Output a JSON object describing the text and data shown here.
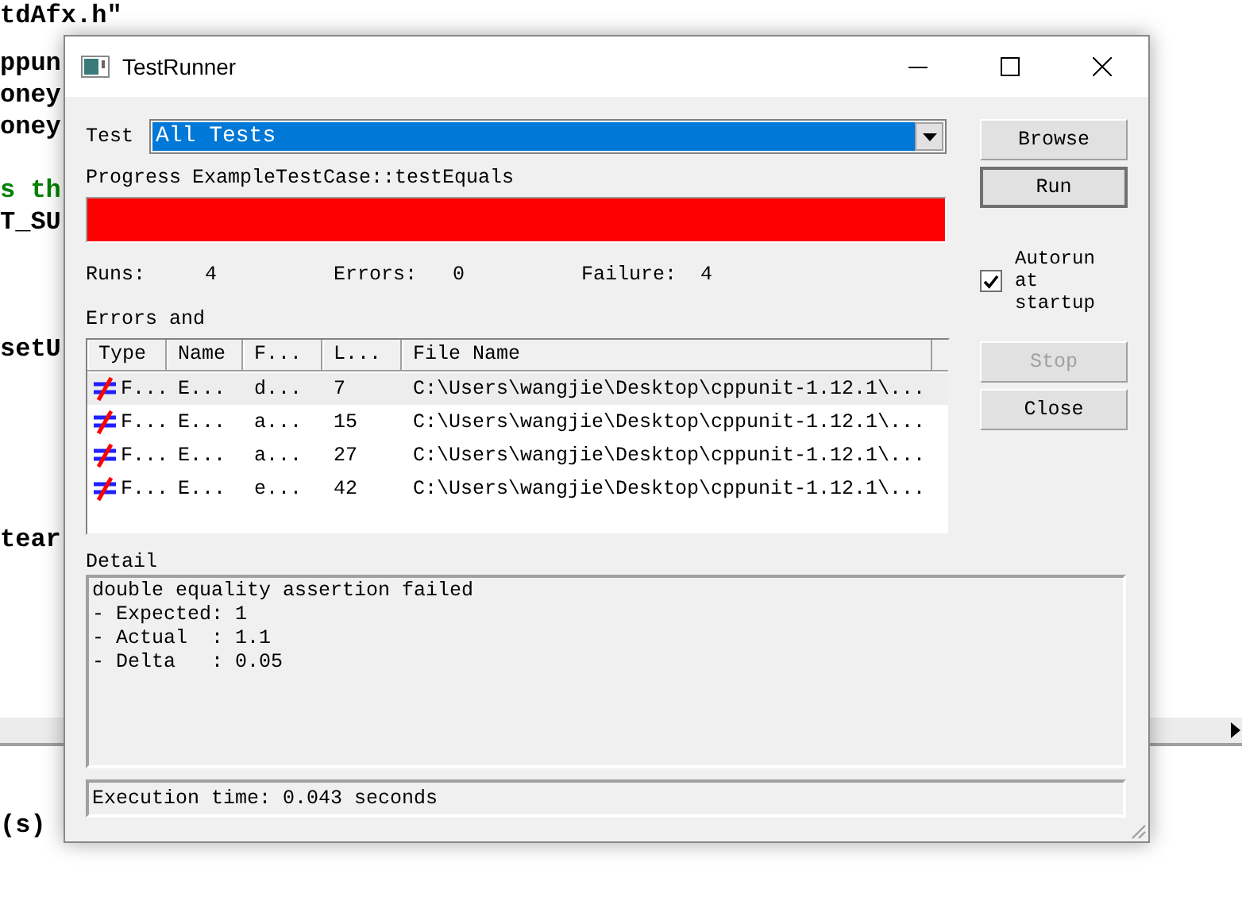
{
  "background_code": [
    {
      "text": "tdAfx.h\"",
      "color": "#000000"
    },
    {
      "text": "ppun",
      "color": "#000000"
    },
    {
      "text": "oney",
      "color": "#000000"
    },
    {
      "text": "oney",
      "color": "#000000"
    },
    {
      "text": "s th",
      "color": "#008000"
    },
    {
      "text": "T_SU",
      "color": "#000000"
    },
    {
      "text": "setU",
      "color": "#000000"
    },
    {
      "text": "tear",
      "color": "#000000"
    },
    {
      "text": "(s)",
      "color": "#000000"
    }
  ],
  "window": {
    "title": "TestRunner"
  },
  "test": {
    "label": "Test",
    "value": "All Tests"
  },
  "progress": {
    "label": "Progress",
    "test_name": "ExampleTestCase::testEquals",
    "level": 1,
    "failed": true
  },
  "stats": [
    {
      "label": "Runs:",
      "value": "4"
    },
    {
      "label": "Errors:",
      "value": "0"
    },
    {
      "label": "Failure:",
      "value": "4"
    }
  ],
  "errors": {
    "label": "Errors and",
    "columns": [
      "Type",
      "Name",
      "F...",
      "L...",
      "File Name"
    ],
    "rows": [
      {
        "selected": true,
        "cells": [
          "F...",
          "E...",
          "d...",
          "7",
          "C:\\Users\\wangjie\\Desktop\\cppunit-1.12.1\\..."
        ]
      },
      {
        "selected": false,
        "cells": [
          "F...",
          "E...",
          "a...",
          "15",
          "C:\\Users\\wangjie\\Desktop\\cppunit-1.12.1\\..."
        ]
      },
      {
        "selected": false,
        "cells": [
          "F...",
          "E...",
          "a...",
          "27",
          "C:\\Users\\wangjie\\Desktop\\cppunit-1.12.1\\..."
        ]
      },
      {
        "selected": false,
        "cells": [
          "F...",
          "E...",
          "e...",
          "42",
          "C:\\Users\\wangjie\\Desktop\\cppunit-1.12.1\\..."
        ]
      }
    ]
  },
  "buttons": [
    {
      "label": "Browse",
      "default": false,
      "disabled": false
    },
    {
      "label": "Run",
      "default": true,
      "disabled": false
    }
  ],
  "autorun": {
    "label": "Autorun at startup",
    "checked": true
  },
  "buttons_lower": [
    {
      "label": "Stop",
      "default": false,
      "disabled": true
    },
    {
      "label": "Close",
      "default": false,
      "disabled": false
    }
  ],
  "detail": {
    "label": "Detail",
    "lines": [
      "double equality assertion failed",
      "- Expected: 1",
      "- Actual  : 1.1",
      "- Delta   : 0.05"
    ]
  },
  "status_bar": {
    "text": "Execution time: 0.043 seconds"
  }
}
